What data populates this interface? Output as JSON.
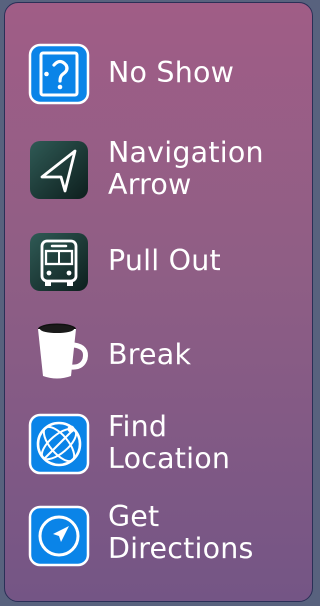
{
  "menu": {
    "items": [
      {
        "label": "No Show",
        "icon": "no-show-door-icon"
      },
      {
        "label": "Navigation\nArrow",
        "icon": "navigation-arrow-icon"
      },
      {
        "label": "Pull Out",
        "icon": "bus-icon"
      },
      {
        "label": "Break",
        "icon": "coffee-cup-icon"
      },
      {
        "label": "Find\nLocation",
        "icon": "globe-locate-icon"
      },
      {
        "label": "Get\nDirections",
        "icon": "compass-directions-icon"
      }
    ]
  },
  "colors": {
    "panel_top": "#a05d86",
    "panel_bottom": "#745585",
    "panel_border": "#2a2f57",
    "blue_icon": "#0a84e8",
    "dark_icon": "#1e3f3c"
  }
}
